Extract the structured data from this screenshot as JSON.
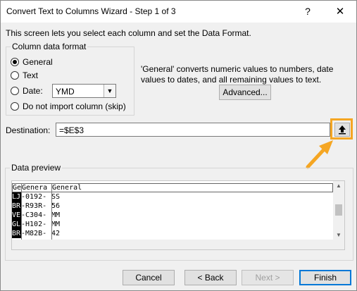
{
  "window": {
    "title": "Convert Text to Columns Wizard - Step 1 of 3",
    "help_label": "?",
    "close_label": "✕"
  },
  "intro": "This screen lets you select each column and set the Data Format.",
  "format_group": {
    "legend": "Column data format",
    "options": [
      {
        "label": "General",
        "checked": true
      },
      {
        "label": "Text",
        "checked": false
      },
      {
        "label": "Date:",
        "checked": false
      },
      {
        "label": "Do not import column (skip)",
        "checked": false
      }
    ],
    "date_format": "YMD"
  },
  "description": "'General' converts numeric values to numbers, date values to dates, and all remaining values to text.",
  "advanced_label": "Advanced...",
  "destination": {
    "label": "Destination:",
    "value": "=$E$3",
    "collapse_icon": "upload-arrow-icon"
  },
  "preview": {
    "legend": "Data preview",
    "header": [
      "Ge",
      "Genera",
      "General"
    ],
    "rows": [
      [
        "LJ",
        "-0192-",
        "SS"
      ],
      [
        "BR",
        "-R93R-",
        "56"
      ],
      [
        "VE",
        "-C304-",
        "MM"
      ],
      [
        "GL",
        "-H102-",
        "MM"
      ],
      [
        "BR",
        "-M82B-",
        "42"
      ]
    ]
  },
  "buttons": {
    "cancel": "Cancel",
    "back": "< Back",
    "next": "Next >",
    "finish": "Finish"
  },
  "colors": {
    "highlight": "#f5a623",
    "default_button_border": "#0078d7"
  }
}
